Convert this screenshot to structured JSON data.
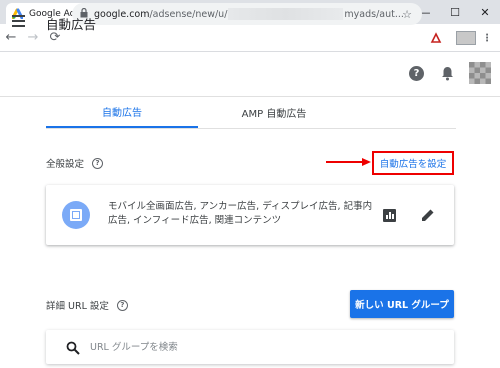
{
  "browser": {
    "tab_title": "Google AdSense",
    "close_tab": "✕",
    "new_tab": "+",
    "url_host": "google.com",
    "url_path_start": "/adsense/new/u/",
    "url_path_end": "myads/aut..."
  },
  "app": {
    "title": "自動広告",
    "help_glyph": "?"
  },
  "tabs": [
    {
      "label": "自動広告"
    },
    {
      "label": "AMP 自動広告"
    }
  ],
  "general": {
    "heading": "全般設定",
    "help_glyph": "?",
    "configure_link": "自動広告を設定",
    "description": "モバイル全画面広告, アンカー広告, ディスプレイ広告, 記事内広告, インフィード広告, 関連コンテンツ"
  },
  "url_settings": {
    "heading": "詳細 URL 設定",
    "help_glyph": "?",
    "new_group_button": "新しい URL グループ",
    "search_placeholder": "URL グループを検索"
  },
  "colors": {
    "accent": "#1a73e8",
    "highlight": "#ee0000"
  }
}
